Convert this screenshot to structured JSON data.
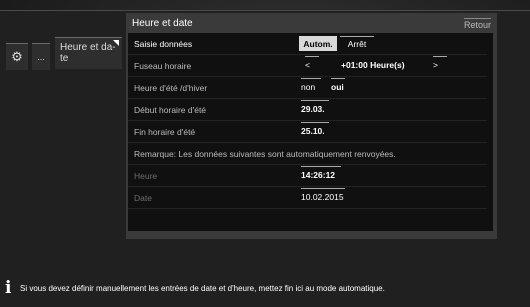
{
  "sidebar": {
    "gear_icon": "gear-icon",
    "more_label": "...",
    "active_tab_label": "Heure et da-\nte"
  },
  "panel": {
    "title": "Heure et date",
    "back_label": "Retour"
  },
  "settings": {
    "saisie": {
      "label": "Saisie données",
      "option_active": "Autom.",
      "option_inactive": "Arrêt"
    },
    "fuseau": {
      "label": "Fuseau horaire",
      "prev": "<",
      "value": "+01:00 Heure(s)",
      "next": ">"
    },
    "ete_hiver": {
      "label": "Heure d'été /d'hiver",
      "option_non": "non",
      "option_oui": "oui"
    },
    "debut": {
      "label": "Début horaire d'été",
      "value": "29.03."
    },
    "fin": {
      "label": "Fin horaire d'été",
      "value": "25.10."
    },
    "remarque": "Remarque: Les données suivantes sont automatiquement renvoyées.",
    "heure": {
      "label": "Heure",
      "value": "14:26:12"
    },
    "date": {
      "label": "Date",
      "value": "10.02.2015"
    }
  },
  "info": {
    "icon": "info-icon",
    "text": "Si vous devez définir manuellement les entrées de date et d'heure, mettez fin ici au mode automatique."
  }
}
